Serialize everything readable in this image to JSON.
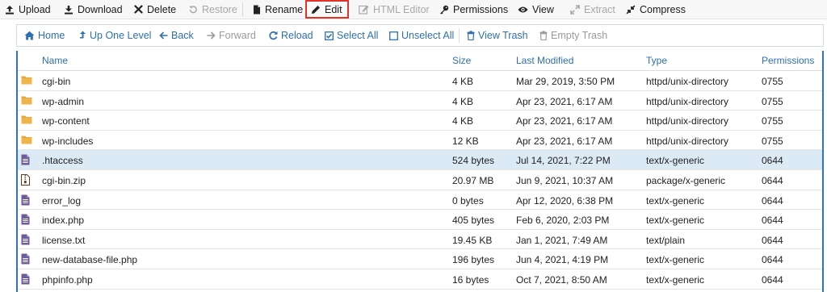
{
  "toolbar": {
    "items": [
      {
        "label": "Upload",
        "icon": "upload-icon",
        "enabled": true
      },
      {
        "label": "Download",
        "icon": "download-icon",
        "enabled": true
      },
      {
        "label": "Delete",
        "icon": "delete-icon",
        "enabled": true
      },
      {
        "label": "Restore",
        "icon": "restore-icon",
        "enabled": false
      },
      {
        "label": "Rename",
        "icon": "rename-icon",
        "enabled": true
      },
      {
        "label": "Edit",
        "icon": "pencil-icon",
        "enabled": true,
        "highlighted": true
      },
      {
        "label": "HTML Editor",
        "icon": "html-editor-icon",
        "enabled": false
      },
      {
        "label": "Permissions",
        "icon": "key-icon",
        "enabled": true
      },
      {
        "label": "View",
        "icon": "eye-icon",
        "enabled": true
      },
      {
        "label": "Extract",
        "icon": "extract-icon",
        "enabled": false
      },
      {
        "label": "Compress",
        "icon": "compress-icon",
        "enabled": true
      }
    ]
  },
  "nav": {
    "items": [
      {
        "label": "Home",
        "icon": "home-icon",
        "enabled": true
      },
      {
        "label": "Up One Level",
        "icon": "up-level-icon",
        "enabled": true
      },
      {
        "label": "Back",
        "icon": "arrow-left-icon",
        "enabled": true
      },
      {
        "label": "Forward",
        "icon": "arrow-right-icon",
        "enabled": false
      },
      {
        "label": "Reload",
        "icon": "reload-icon",
        "enabled": true
      },
      {
        "label": "Select All",
        "icon": "checkbox-checked-icon",
        "enabled": true
      },
      {
        "label": "Unselect All",
        "icon": "checkbox-empty-icon",
        "enabled": true
      },
      {
        "label": "View Trash",
        "icon": "trash-icon",
        "enabled": true
      },
      {
        "label": "Empty Trash",
        "icon": "trash-icon",
        "enabled": false
      }
    ]
  },
  "table": {
    "columns": [
      "Name",
      "Size",
      "Last Modified",
      "Type",
      "Permissions"
    ],
    "rows": [
      {
        "name": "cgi-bin",
        "size": "4 KB",
        "modified": "Mar 29, 2019, 3:50 PM",
        "type": "httpd/unix-directory",
        "perms": "0755",
        "icon": "folder-icon"
      },
      {
        "name": "wp-admin",
        "size": "4 KB",
        "modified": "Apr 23, 2021, 6:17 AM",
        "type": "httpd/unix-directory",
        "perms": "0755",
        "icon": "folder-icon"
      },
      {
        "name": "wp-content",
        "size": "4 KB",
        "modified": "Apr 23, 2021, 6:17 AM",
        "type": "httpd/unix-directory",
        "perms": "0755",
        "icon": "folder-icon"
      },
      {
        "name": "wp-includes",
        "size": "12 KB",
        "modified": "Apr 23, 2021, 6:17 AM",
        "type": "httpd/unix-directory",
        "perms": "0755",
        "icon": "folder-icon"
      },
      {
        "name": ".htaccess",
        "size": "524 bytes",
        "modified": "Jul 14, 2021, 7:22 PM",
        "type": "text/x-generic",
        "perms": "0644",
        "icon": "text-file-icon",
        "selected": true
      },
      {
        "name": "cgi-bin.zip",
        "size": "20.97 MB",
        "modified": "Jun 9, 2021, 10:37 AM",
        "type": "package/x-generic",
        "perms": "0644",
        "icon": "zip-file-icon"
      },
      {
        "name": "error_log",
        "size": "0 bytes",
        "modified": "Apr 12, 2020, 6:38 PM",
        "type": "text/x-generic",
        "perms": "0644",
        "icon": "text-file-icon"
      },
      {
        "name": "index.php",
        "size": "405 bytes",
        "modified": "Feb 6, 2020, 2:03 PM",
        "type": "text/x-generic",
        "perms": "0644",
        "icon": "text-file-icon"
      },
      {
        "name": "license.txt",
        "size": "19.45 KB",
        "modified": "Jan 1, 2021, 7:49 AM",
        "type": "text/plain",
        "perms": "0644",
        "icon": "text-file-icon"
      },
      {
        "name": "new-database-file.php",
        "size": "196 bytes",
        "modified": "Jun 4, 2021, 4:19 PM",
        "type": "text/x-generic",
        "perms": "0644",
        "icon": "text-file-icon"
      },
      {
        "name": "phpinfo.php",
        "size": "16 bytes",
        "modified": "Oct 7, 2021, 8:50 AM",
        "type": "text/x-generic",
        "perms": "0644",
        "icon": "text-file-icon"
      }
    ]
  },
  "colors": {
    "link": "#2c6fb3",
    "highlight_border": "#e0342a",
    "selected_row": "#dceaf6",
    "table_border": "#3071c4",
    "folder": "#e7a83a",
    "file": "#6f5a9a"
  }
}
